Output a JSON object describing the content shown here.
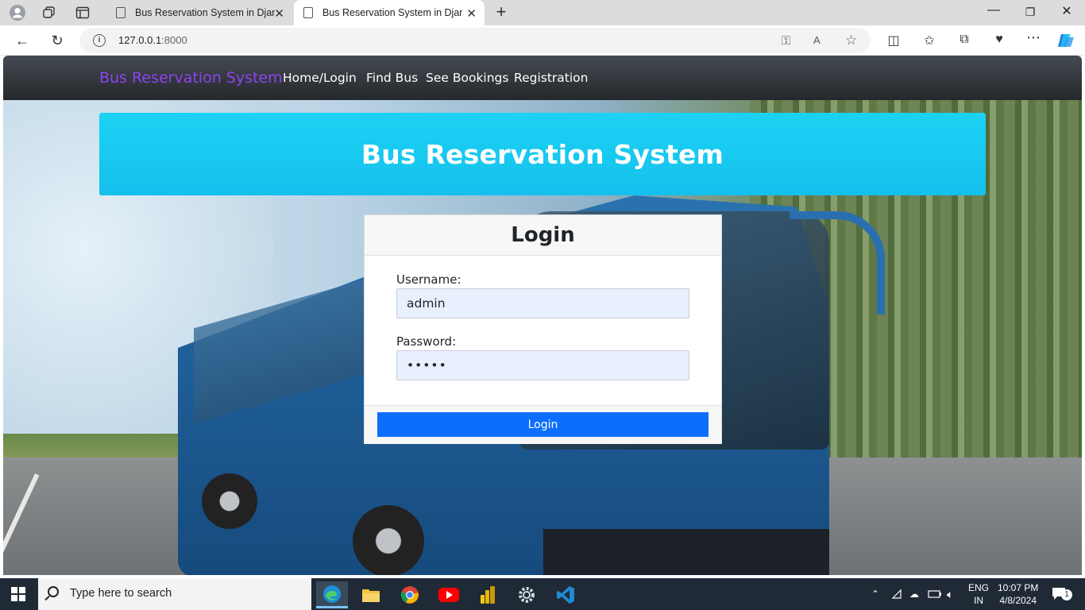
{
  "browser": {
    "tabs": [
      {
        "title": "Bus Reservation System in Django",
        "active": false
      },
      {
        "title": "Bus Reservation System in Django",
        "active": true
      }
    ],
    "address": {
      "host": "127.0.0.1",
      "port": ":8000"
    },
    "icons": [
      "profile-icon",
      "workspaces-icon",
      "tab-actions-icon",
      "new-tab-icon",
      "back-icon",
      "refresh-icon",
      "info-icon",
      "key-icon",
      "read-aloud-icon",
      "favorite-star-icon",
      "split-screen-icon",
      "favorites-icon",
      "collections-icon",
      "browser-essentials-icon",
      "more-icon",
      "copilot-icon"
    ]
  },
  "navbar": {
    "brand": "Bus Reservation System",
    "links": [
      "Home/Login",
      "Find Bus",
      "See Bookings",
      "Registration"
    ],
    "brand_color": "#8e44ef"
  },
  "jumbotron": {
    "title": "Bus Reservation System",
    "color": "#1cd2f4"
  },
  "login_card": {
    "title": "Login",
    "username_label": "Username:",
    "username_value": "admin",
    "password_label": "Password:",
    "password_value": "•••••",
    "button_label": "Login",
    "button_color": "#0d6efd"
  },
  "taskbar": {
    "search_placeholder": "Type here to search",
    "apps": [
      "edge-icon",
      "file-explorer-icon",
      "chrome-icon",
      "youtube-icon",
      "power-bi-icon",
      "settings-icon",
      "vscode-icon"
    ],
    "language": "ENG",
    "region": "IN",
    "time": "10:07 PM",
    "date": "4/8/2024",
    "notification_count": "1"
  }
}
